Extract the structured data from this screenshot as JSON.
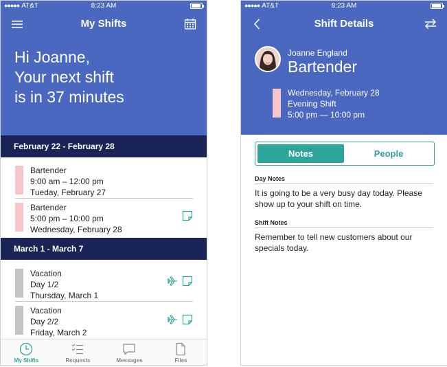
{
  "status_bar": {
    "carrier": "AT&T",
    "time": "8:23 AM"
  },
  "my_shifts": {
    "title": "My Shifts",
    "greeting_lines": [
      "Hi Joanne,",
      "Your next shift",
      "is in 37 minutes"
    ],
    "weeks": [
      {
        "header": "February 22 - February 28",
        "shifts": [
          {
            "lines": [
              "Bartender",
              "9:00 am – 12:00 pm",
              "Tueday, February 27"
            ],
            "color": "#f7c6cb",
            "icons": []
          },
          {
            "lines": [
              "Bartender",
              "5:00 pm – 10:00 pm",
              "Wednesday, February 28"
            ],
            "color": "#f7c6cb",
            "icons": [
              "note-icon"
            ]
          }
        ]
      },
      {
        "header": "March 1 - March 7",
        "shifts": [
          {
            "lines": [
              "Vacation",
              "Day 1/2",
              "Thursday, March 1"
            ],
            "color": "#c4c4c4",
            "icons": [
              "airplane-icon",
              "note-icon"
            ]
          },
          {
            "lines": [
              "Vacation",
              "Day 2/2",
              "Friday, March 2"
            ],
            "color": "#c4c4c4",
            "icons": [
              "airplane-icon",
              "note-icon"
            ]
          }
        ]
      }
    ],
    "tabs": [
      {
        "label": "My Shifts",
        "icon": "clock-icon",
        "active": true
      },
      {
        "label": "Requests",
        "icon": "checklist-icon",
        "active": false
      },
      {
        "label": "Messages",
        "icon": "chat-icon",
        "active": false
      },
      {
        "label": "Files",
        "icon": "file-icon",
        "active": false
      }
    ]
  },
  "shift_details": {
    "title": "Shift Details",
    "person_name": "Joanne England",
    "role": "Bartender",
    "details": [
      "Wednesday, February 28",
      "Evening Shift",
      "5:00 pm — 10:00 pm"
    ],
    "segment": {
      "notes": "Notes",
      "people": "People"
    },
    "day_notes_label": "Day Notes",
    "day_notes": "It is going to be a very busy day today. Please show up to your shift on time.",
    "shift_notes_label": "Shift Notes",
    "shift_notes": "Remember to tell new customers about our specials today."
  },
  "colors": {
    "brand_blue": "#4a68c0",
    "navy": "#1a2456",
    "teal": "#2ea59a",
    "shift_pink": "#f7c6cb",
    "vacation_gray": "#c4c4c4"
  }
}
